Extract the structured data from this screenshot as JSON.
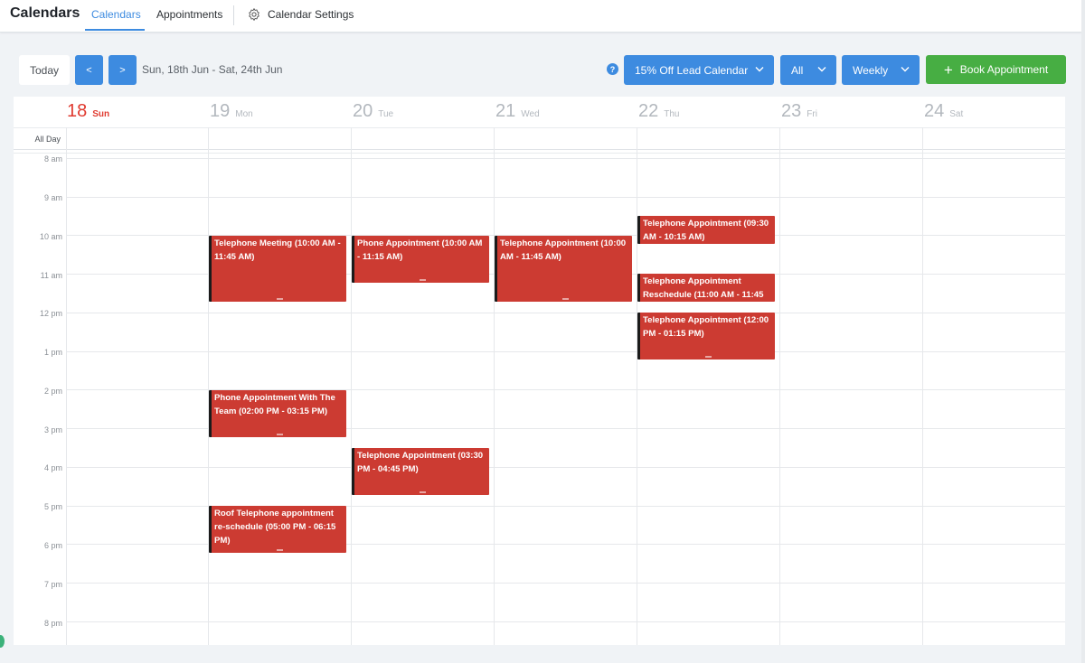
{
  "header": {
    "app_title": "Calendars",
    "tabs": [
      {
        "label": "Calendars",
        "active": true
      },
      {
        "label": "Appointments",
        "active": false
      }
    ],
    "settings_label": "Calendar Settings",
    "settings_icon": "gear-icon"
  },
  "toolbar": {
    "today_label": "Today",
    "prev_label": "<",
    "next_label": ">",
    "date_range": "Sun, 18th Jun - Sat, 24th Jun",
    "help_label": "?",
    "calendar_select": "15% Off Lead Calendar",
    "filter_select": "All",
    "view_select": "Weekly",
    "book_label": "Book Appointment"
  },
  "calendar": {
    "all_day_label": "All Day",
    "days": [
      {
        "num": "18",
        "name": "Sun",
        "today": true
      },
      {
        "num": "19",
        "name": "Mon",
        "today": false
      },
      {
        "num": "20",
        "name": "Tue",
        "today": false
      },
      {
        "num": "21",
        "name": "Wed",
        "today": false
      },
      {
        "num": "22",
        "name": "Thu",
        "today": false
      },
      {
        "num": "23",
        "name": "Fri",
        "today": false
      },
      {
        "num": "24",
        "name": "Sat",
        "today": false
      }
    ],
    "hours": [
      "8 am",
      "9 am",
      "10 am",
      "11 am",
      "12 pm",
      "1 pm",
      "2 pm",
      "3 pm",
      "4 pm",
      "5 pm",
      "6 pm",
      "7 pm",
      "8 pm"
    ],
    "events": [
      {
        "title": "Telephone Meeting (10:00 AM - 11:45 AM)",
        "day": 1
      },
      {
        "title": "Phone Appointment With The Team (02:00 PM - 03:15 PM)",
        "day": 1
      },
      {
        "title": "Roof Telephone appointment re-schedule (05:00 PM - 06:15 PM)",
        "day": 1
      },
      {
        "title": "Phone Appointment (10:00 AM - 11:15 AM)",
        "day": 2
      },
      {
        "title": "Telephone Appointment (03:30 PM - 04:45 PM)",
        "day": 2
      },
      {
        "title": "Telephone Appointment (10:00 AM - 11:45 AM)",
        "day": 3
      },
      {
        "title": "Telephone Appointment (09:30 AM - 10:15 AM)",
        "day": 4
      },
      {
        "title": "Telephone Appointment Reschedule (11:00 AM - 11:45",
        "day": 4
      },
      {
        "title": "Telephone Appointment (12:00 PM - 01:15 PM)",
        "day": 4
      }
    ],
    "colors": {
      "event": "#cc3b32",
      "today": "#e03a2f",
      "primary": "#3d8be0",
      "success": "#47ae43"
    }
  }
}
